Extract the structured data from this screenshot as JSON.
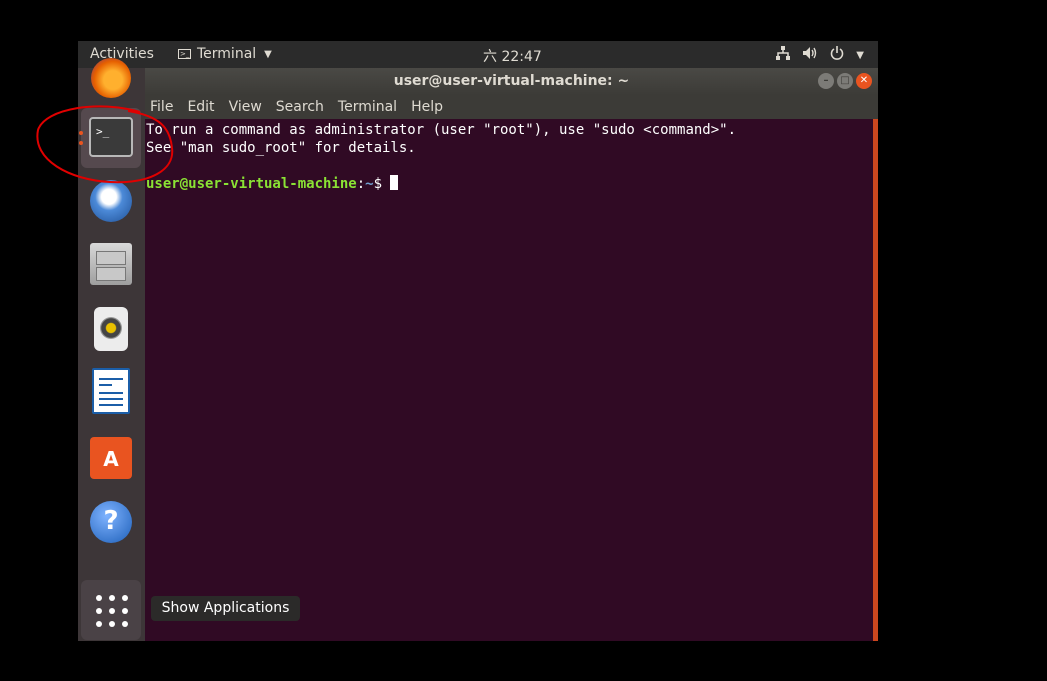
{
  "top_panel": {
    "activities": "Activities",
    "app_menu": "Terminal",
    "clock": "六 22:47",
    "tray_icons": [
      "network-icon",
      "volume-icon",
      "power-icon",
      "chevron-down-icon"
    ]
  },
  "dock": {
    "items": [
      "firefox",
      "terminal",
      "thunderbird",
      "files",
      "rhythmbox",
      "libreoffice-writer",
      "ubuntu-software",
      "help"
    ],
    "active_item": "terminal",
    "show_apps_tooltip": "Show Applications"
  },
  "window": {
    "title": "user@user-virtual-machine: ~",
    "menu": [
      "File",
      "Edit",
      "View",
      "Search",
      "Terminal",
      "Help"
    ],
    "terminal": {
      "line1": "To run a command as administrator (user \"root\"), use \"sudo <command>\".",
      "line2": "See \"man sudo_root\" for details.",
      "prompt_user": "user@user-virtual-machine",
      "prompt_sep": ":",
      "prompt_path": "~",
      "prompt_symbol": "$"
    }
  },
  "colors": {
    "accent": "#e95420",
    "terminal_bg": "#300a24",
    "annotation": "#e00000"
  }
}
